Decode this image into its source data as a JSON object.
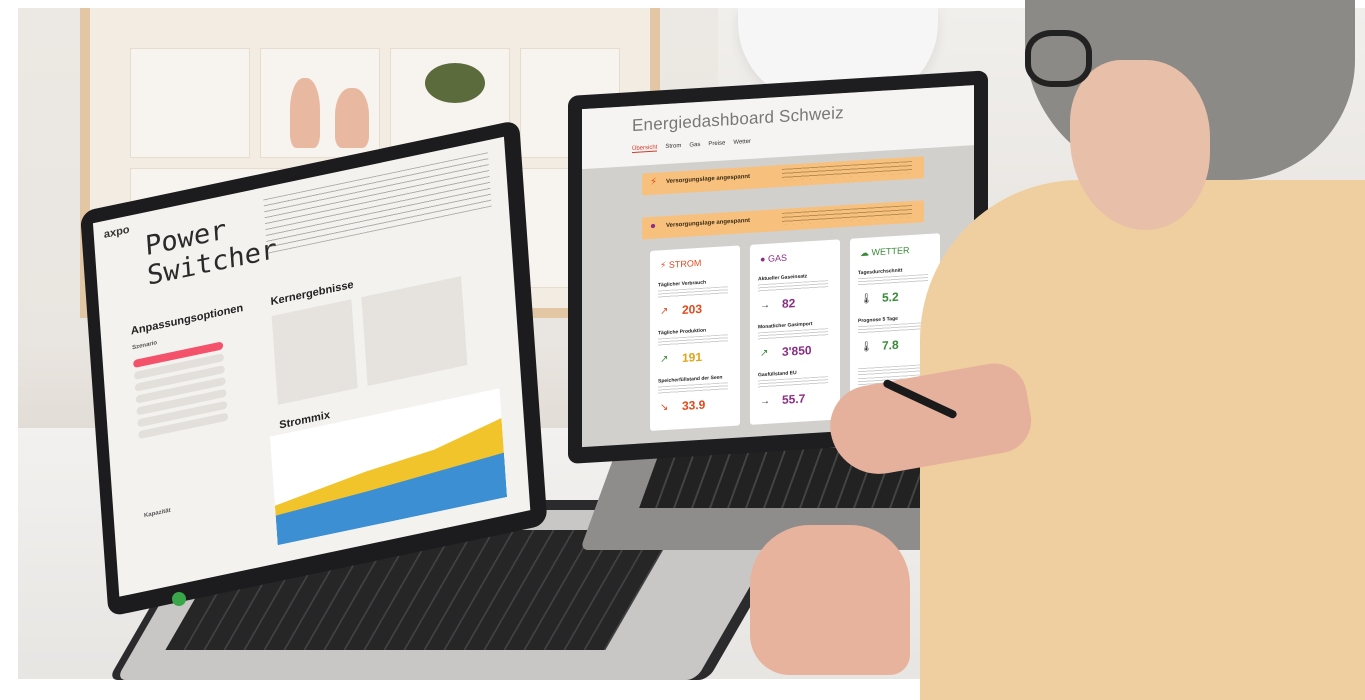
{
  "left_laptop": {
    "logo": "axpo",
    "title_line1": "Power",
    "title_line2": "Switcher",
    "section_options": "Anpassungsoptionen",
    "section_results": "Kernergebnisse",
    "section_mix": "Strommix",
    "scenario_label": "Szenario",
    "capacity_label": "Kapazität"
  },
  "right_laptop": {
    "title": "Energiedashboard Schweiz",
    "nav": [
      "Übersicht",
      "Strom",
      "Gas",
      "Preise",
      "Wetter"
    ],
    "alerts": [
      "Versorgungslage angespannt",
      "Versorgungslage angespannt"
    ],
    "cards": [
      {
        "name": "STROM",
        "color": "#e24a1f",
        "items": [
          {
            "label": "Täglicher Verbrauch",
            "value": "203",
            "color": "#e24a1f"
          },
          {
            "label": "Tägliche Produktion",
            "value": "191",
            "color": "#e0a41a"
          },
          {
            "label": "Speicherfüllstand der Seen",
            "value": "33.9",
            "color": "#e24a1f"
          }
        ]
      },
      {
        "name": "GAS",
        "color": "#8a2e86",
        "items": [
          {
            "label": "Aktueller Gaseinsatz",
            "value": "82",
            "color": "#8a2e86"
          },
          {
            "label": "Monatlicher Gasimport",
            "value": "3'850",
            "color": "#8a2e86"
          },
          {
            "label": "Gasfüllstand EU",
            "value": "55.7",
            "color": "#8a2e86"
          }
        ]
      },
      {
        "name": "WETTER",
        "color": "#3a8a3a",
        "items": [
          {
            "label": "Tagesdurchschnitt",
            "value": "5.2",
            "color": "#3a8a3a"
          },
          {
            "label": "Prognose 5 Tage",
            "value": "7.8",
            "color": "#3a8a3a"
          }
        ]
      }
    ]
  }
}
